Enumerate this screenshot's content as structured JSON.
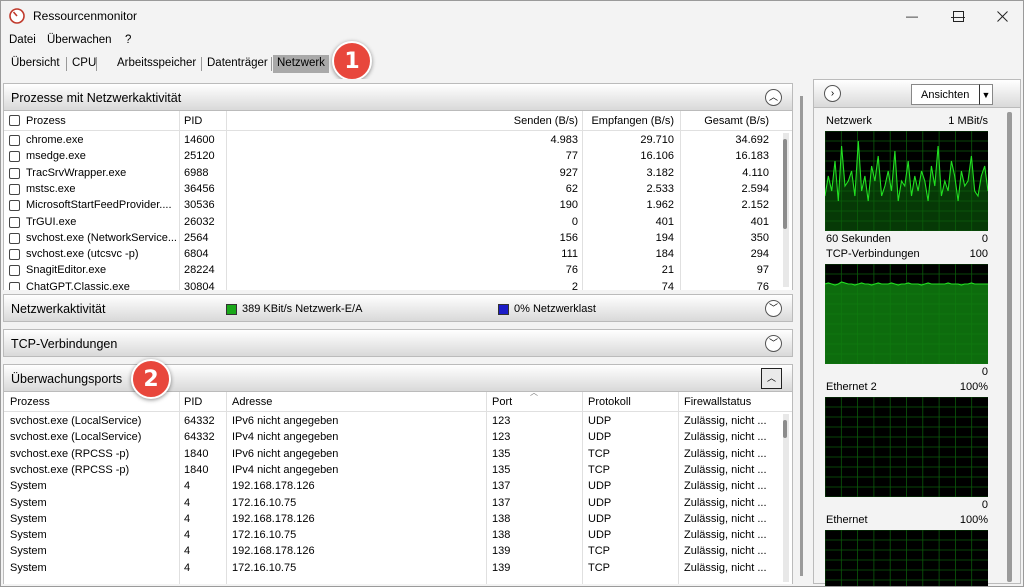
{
  "window": {
    "title": "Ressourcenmonitor"
  },
  "menu": [
    "Datei",
    "Überwachen",
    "?"
  ],
  "tabs": [
    {
      "label": "Übersicht",
      "active": false
    },
    {
      "label": "CPU",
      "active": false
    },
    {
      "label": "Arbeitsspeicher",
      "active": false
    },
    {
      "label": "Datenträger",
      "active": false
    },
    {
      "label": "Netzwerk",
      "active": true
    }
  ],
  "badges": [
    "1",
    "2"
  ],
  "processes": {
    "title": "Prozesse mit Netzwerkaktivität",
    "headers": [
      "Prozess",
      "PID",
      "Senden (B/s)",
      "Empfangen (B/s)",
      "Gesamt (B/s)"
    ],
    "rows": [
      [
        "chrome.exe",
        "14600",
        "4.983",
        "29.710",
        "34.692"
      ],
      [
        "msedge.exe",
        "25120",
        "77",
        "16.106",
        "16.183"
      ],
      [
        "TracSrvWrapper.exe",
        "6988",
        "927",
        "3.182",
        "4.110"
      ],
      [
        "mstsc.exe",
        "36456",
        "62",
        "2.533",
        "2.594"
      ],
      [
        "MicrosoftStartFeedProvider....",
        "30536",
        "190",
        "1.962",
        "2.152"
      ],
      [
        "TrGUI.exe",
        "26032",
        "0",
        "401",
        "401"
      ],
      [
        "svchost.exe (NetworkService...",
        "2564",
        "156",
        "194",
        "350"
      ],
      [
        "svchost.exe (utcsvc -p)",
        "6804",
        "111",
        "184",
        "294"
      ],
      [
        "SnagitEditor.exe",
        "28224",
        "76",
        "21",
        "97"
      ],
      [
        "ChatGPT.Classic.exe",
        "30804",
        "2",
        "74",
        "76"
      ]
    ]
  },
  "network_activity": {
    "title": "Netzwerkaktivität",
    "io_label": "389 KBit/s Netzwerk-E/A",
    "load_label": "0% Netzwerklast",
    "io_color": "#1aa81a",
    "load_color": "#1c1cc8"
  },
  "tcp": {
    "title": "TCP-Verbindungen"
  },
  "ports": {
    "title": "Überwachungsports",
    "headers": [
      "Prozess",
      "PID",
      "Adresse",
      "Port",
      "Protokoll",
      "Firewallstatus"
    ],
    "rows": [
      [
        "svchost.exe (LocalService)",
        "64332",
        "IPv6 nicht angegeben",
        "123",
        "UDP",
        "Zulässig, nicht ..."
      ],
      [
        "svchost.exe (LocalService)",
        "64332",
        "IPv4 nicht angegeben",
        "123",
        "UDP",
        "Zulässig, nicht ..."
      ],
      [
        "svchost.exe (RPCSS -p)",
        "1840",
        "IPv6 nicht angegeben",
        "135",
        "TCP",
        "Zulässig, nicht ..."
      ],
      [
        "svchost.exe (RPCSS -p)",
        "1840",
        "IPv4 nicht angegeben",
        "135",
        "TCP",
        "Zulässig, nicht ..."
      ],
      [
        "System",
        "4",
        "192.168.178.126",
        "137",
        "UDP",
        "Zulässig, nicht ..."
      ],
      [
        "System",
        "4",
        "172.16.10.75",
        "137",
        "UDP",
        "Zulässig, nicht ..."
      ],
      [
        "System",
        "4",
        "192.168.178.126",
        "138",
        "UDP",
        "Zulässig, nicht ..."
      ],
      [
        "System",
        "4",
        "172.16.10.75",
        "138",
        "UDP",
        "Zulässig, nicht ..."
      ],
      [
        "System",
        "4",
        "192.168.178.126",
        "139",
        "TCP",
        "Zulässig, nicht ..."
      ],
      [
        "System",
        "4",
        "172.16.10.75",
        "139",
        "TCP",
        "Zulässig, nicht ..."
      ]
    ]
  },
  "right_panel": {
    "views_label": "Ansichten",
    "graphs": [
      {
        "name": "Netzwerk",
        "max": "1 MBit/s",
        "footer_left": "60 Sekunden",
        "footer_right": "0",
        "trace": [
          0.35,
          0.55,
          0.4,
          0.7,
          0.3,
          0.85,
          0.45,
          0.5,
          0.6,
          0.35,
          0.9,
          0.4,
          0.55,
          0.3,
          0.65,
          0.5,
          0.75,
          0.35,
          0.45,
          0.6,
          0.4,
          0.8,
          0.3,
          0.5,
          0.45,
          0.7,
          0.35,
          0.55,
          0.4,
          0.6,
          0.5,
          0.3,
          0.65,
          0.45,
          0.85,
          0.35,
          0.5,
          0.4,
          0.7,
          0.55,
          0.3,
          0.6,
          0.45,
          0.5,
          0.75,
          0.4,
          0.35,
          0.55,
          0.65,
          0.4
        ]
      },
      {
        "name": "TCP-Verbindungen",
        "max": "100",
        "footer_right": "0",
        "trace": [
          0.8,
          0.81,
          0.8,
          0.79,
          0.8,
          0.82,
          0.81,
          0.8,
          0.8,
          0.79,
          0.8,
          0.81,
          0.8,
          0.8,
          0.79,
          0.8,
          0.81,
          0.8,
          0.8,
          0.8,
          0.81,
          0.8,
          0.79,
          0.8,
          0.8,
          0.81,
          0.8,
          0.8,
          0.8,
          0.79,
          0.8,
          0.81,
          0.8,
          0.8,
          0.8,
          0.8,
          0.8,
          0.81,
          0.8,
          0.8,
          0.8,
          0.79,
          0.8,
          0.8,
          0.81,
          0.8,
          0.8,
          0.8,
          0.8,
          0.8
        ]
      },
      {
        "name": "Ethernet 2",
        "max": "100%",
        "footer_right": "0",
        "trace": []
      },
      {
        "name": "Ethernet",
        "max": "100%",
        "footer_right": "",
        "trace": []
      }
    ]
  }
}
